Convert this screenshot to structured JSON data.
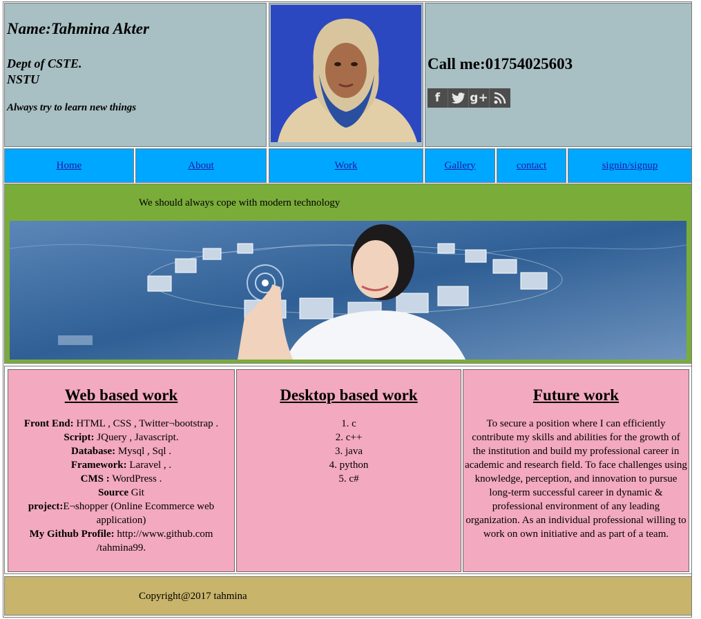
{
  "header": {
    "name": "Name:Tahmina Akter",
    "dept_line1": "Dept of CSTE.",
    "dept_line2": "NSTU",
    "motto": "Always try to learn new things",
    "call": "Call me:01754025603",
    "social": [
      {
        "icon": "facebook-icon",
        "glyph": "f"
      },
      {
        "icon": "twitter-icon",
        "glyph": "t"
      },
      {
        "icon": "google-plus-icon",
        "glyph": "g+"
      },
      {
        "icon": "rss-icon",
        "glyph": "≋"
      }
    ]
  },
  "nav": {
    "home": "Home",
    "about": "About",
    "work": "Work",
    "gallery": "Gallery",
    "contact": "contact",
    "signin": "signin/signup"
  },
  "banner": {
    "tagline": "We should always cope with modern technology"
  },
  "work": {
    "web": {
      "title": "Web based work",
      "frontend_label": "Front End:",
      "frontend_value": " HTML , CSS , Twitter¬bootstrap .",
      "script_label": "Script:",
      "script_value": " JQuery , Javascript.",
      "database_label": "Database:",
      "database_value": " Mysql , Sql .",
      "framework_label": "Framework:",
      "framework_value": " Laravel , .",
      "cms_label": "CMS :",
      "cms_value": " WordPress .",
      "source_label": "Source",
      "source_value": " Git",
      "project_label": "project:",
      "project_value": "E¬shopper (Online Ecommerce web application)",
      "github_label": "My Github Profile:",
      "github_value": " http://www.github.com /tahmina99."
    },
    "desktop": {
      "title": "Desktop based work",
      "items": [
        "1. c",
        "2. c++",
        "3. java",
        "4. python",
        "5. c#"
      ]
    },
    "future": {
      "title": "Future work",
      "text": "To secure a position where I can efficiently contribute my skills and abilities for the growth of the institution and build my professional career in academic and research field. To face challenges using knowledge, perception, and innovation to pursue long-term successful career in dynamic & professional environment of any leading organization. As an individual professional willing to work on own initiative and as part of a team."
    }
  },
  "footer": {
    "copyright": "Copyright@2017 tahmina"
  },
  "colors": {
    "header_bg": "#a8bfc3",
    "nav_bg": "#00a7ff",
    "banner_bg": "#7aac3a",
    "work_bg": "#f3a9bf",
    "footer_bg": "#c8b46a",
    "link": "#1a1aa6"
  }
}
